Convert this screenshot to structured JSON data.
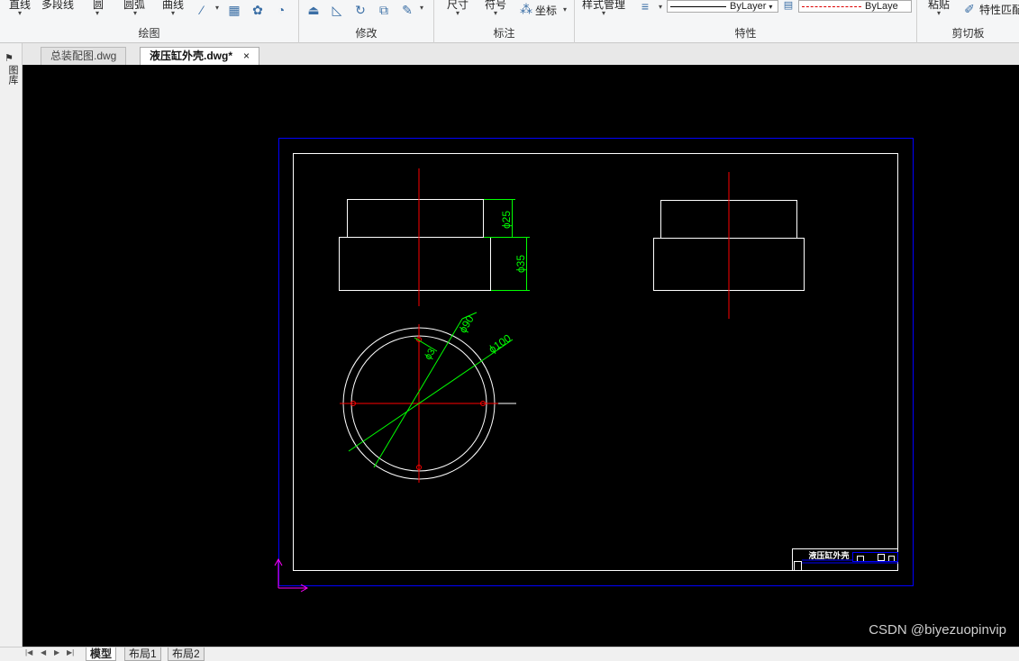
{
  "ribbon": {
    "draw": {
      "label": "绘图",
      "buttons": [
        "直线",
        "多段线",
        "圆",
        "圆弧",
        "曲线"
      ]
    },
    "modify": {
      "label": "修改"
    },
    "annotate": {
      "label": "标注",
      "buttons": [
        "尺寸",
        "符号",
        "坐标"
      ]
    },
    "properties": {
      "label": "特性",
      "style_manager": "样式管理",
      "linetype1": "ByLayer",
      "linetype2": "ByLaye"
    },
    "clipboard": {
      "label": "剪切板",
      "paste": "粘贴",
      "match_props": "特性匹配"
    }
  },
  "side_strip": {
    "label": "图库"
  },
  "tabs": [
    {
      "label": "总装配图.dwg",
      "active": false
    },
    {
      "label": "液压缸外壳.dwg*",
      "active": true,
      "close": "×"
    }
  ],
  "layout_tabs": [
    {
      "label": "模型",
      "active": true
    },
    {
      "label": "布局1",
      "active": false
    },
    {
      "label": "布局2",
      "active": false
    }
  ],
  "drawing": {
    "dimensions": {
      "d25": "ϕ25",
      "d35": "ϕ35",
      "d90": "ϕ90",
      "d100": "ϕ100",
      "d3": "ϕ3"
    },
    "title_block_text": "液压缸外壳"
  },
  "colors": {
    "canvas": "#000000",
    "geometry": "#ffffff",
    "centerline": "#ff0000",
    "dimension": "#00ff00",
    "sheet_border": "#0000ff",
    "ucs": "#ff00ff"
  },
  "watermark": "CSDN @biyezuopinvip"
}
